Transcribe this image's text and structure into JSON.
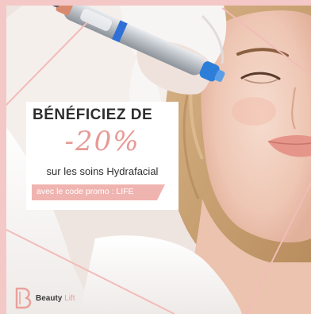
{
  "promo": {
    "headline": "BÉNÉFICIEZ DE",
    "discount": "-20%",
    "subline": "sur les soins Hydrafacial",
    "code_text": "avec le code promo : LIFE"
  },
  "brand": {
    "name_part1": "Beauty",
    "name_part2": "Lift"
  },
  "colors": {
    "accent_pink": "#f0b4b0",
    "discount_pink": "#e79a95",
    "frame_pink": "#f4c8c6",
    "headline_text": "#2e2e2e"
  },
  "icons": {
    "logo": "beauty-lift-b-logo",
    "device": "hydrafacial-handpiece"
  }
}
